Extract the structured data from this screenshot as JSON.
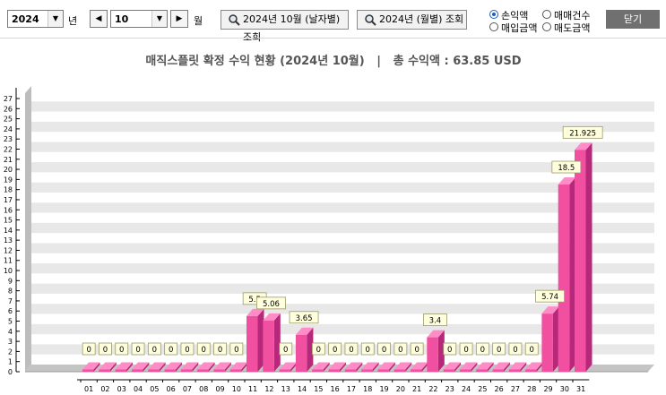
{
  "toolbar": {
    "year_value": "2024",
    "year_unit": "년",
    "month_value": "10",
    "month_unit": "월",
    "prev_glyph": "◀",
    "next_glyph": "▶",
    "dropdown_glyph": "▼",
    "query_daily_label": "2024년 10월 (날자별) 조회",
    "query_monthly_label": "2024년 (월별) 조회",
    "radios": [
      {
        "label": "손익액",
        "checked": true
      },
      {
        "label": "매매건수",
        "checked": false
      },
      {
        "label": "매입금액",
        "checked": false
      },
      {
        "label": "매도금액",
        "checked": false
      }
    ],
    "close_label": "닫기"
  },
  "chart_data": {
    "type": "bar",
    "title": "매직스플릿 확정 수익 현황 (2024년 10월)   |   총 수익액 : 63.85 USD",
    "categories": [
      "01",
      "02",
      "03",
      "04",
      "05",
      "06",
      "07",
      "08",
      "09",
      "10",
      "11",
      "12",
      "13",
      "14",
      "15",
      "16",
      "17",
      "18",
      "19",
      "20",
      "21",
      "22",
      "23",
      "24",
      "25",
      "26",
      "27",
      "28",
      "29",
      "30",
      "31"
    ],
    "values": [
      0,
      0,
      0,
      0,
      0,
      0,
      0,
      0,
      0,
      0,
      5.5,
      5.06,
      0,
      3.65,
      0,
      0,
      0,
      0,
      0,
      0,
      0,
      3.4,
      0,
      0,
      0,
      0,
      0,
      0,
      5.74,
      18.5,
      21.925
    ],
    "data_labels": [
      "0",
      "0",
      "0",
      "0",
      "0",
      "0",
      "0",
      "0",
      "0",
      "0",
      "5.5",
      "5.06",
      "0",
      "3.65",
      "0",
      "0",
      "0",
      "0",
      "0",
      "0",
      "0",
      "3.4",
      "0",
      "0",
      "0",
      "0",
      "0",
      "0",
      "5.74",
      "18.5",
      "21.925"
    ],
    "ylim": [
      0,
      27
    ],
    "yticks": [
      "0",
      "1",
      "2",
      "3",
      "4",
      "5",
      "6",
      "7",
      "8",
      "9",
      "10",
      "11",
      "12",
      "13",
      "14",
      "15",
      "16",
      "17",
      "18",
      "19",
      "20",
      "21",
      "22",
      "23",
      "24",
      "25",
      "26",
      "27"
    ],
    "grid": true,
    "bar_color": "#f0509f",
    "bar_top_color": "#ff8cc6",
    "bar_side_color": "#b8287a",
    "label_bg_color": "#ffffdd"
  }
}
